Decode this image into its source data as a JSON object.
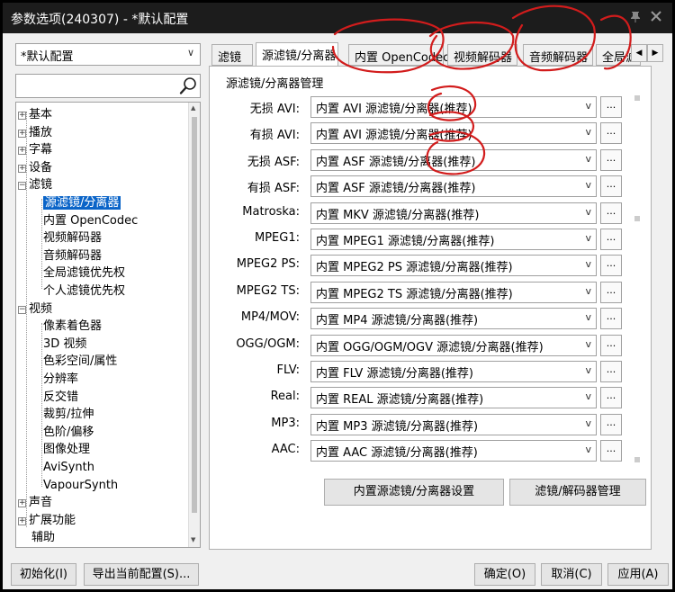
{
  "window": {
    "title": "参数选项(240307) - *默认配置"
  },
  "profile": {
    "selected": "*默认配置"
  },
  "tree": {
    "items": [
      {
        "label": "基本",
        "expander": "+"
      },
      {
        "label": "播放",
        "expander": "+"
      },
      {
        "label": "字幕",
        "expander": "+"
      },
      {
        "label": "设备",
        "expander": "+"
      },
      {
        "label": "滤镜",
        "expander": "−"
      },
      {
        "label": "源滤镜/分离器",
        "selected": true
      },
      {
        "label": "内置 OpenCodec"
      },
      {
        "label": "视频解码器"
      },
      {
        "label": "音频解码器"
      },
      {
        "label": "全局滤镜优先权"
      },
      {
        "label": "个人滤镜优先权"
      },
      {
        "label": "视频",
        "expander": "−"
      },
      {
        "label": "像素着色器"
      },
      {
        "label": "3D 视频"
      },
      {
        "label": "色彩空间/属性"
      },
      {
        "label": "分辨率"
      },
      {
        "label": "反交错"
      },
      {
        "label": "裁剪/拉伸"
      },
      {
        "label": "色阶/偏移"
      },
      {
        "label": "图像处理"
      },
      {
        "label": "AviSynth"
      },
      {
        "label": "VapourSynth"
      },
      {
        "label": "声音",
        "expander": "+"
      },
      {
        "label": "扩展功能",
        "expander": "+"
      },
      {
        "label": "辅助"
      }
    ]
  },
  "tabs": {
    "items": [
      "滤镜",
      "源滤镜/分离器",
      "内置 OpenCodec",
      "视频解码器",
      "音频解码器",
      "全局滤"
    ],
    "active": 1
  },
  "panel": {
    "group_title": "源滤镜/分离器管理",
    "rows": [
      {
        "label": "无损 AVI:",
        "value": "内置 AVI 源滤镜/分离器(推荐)"
      },
      {
        "label": "有损 AVI:",
        "value": "内置 AVI 源滤镜/分离器(推荐)"
      },
      {
        "label": "无损 ASF:",
        "value": "内置 ASF 源滤镜/分离器(推荐)"
      },
      {
        "label": "有损 ASF:",
        "value": "内置 ASF 源滤镜/分离器(推荐)"
      },
      {
        "label": "Matroska:",
        "value": "内置 MKV 源滤镜/分离器(推荐)"
      },
      {
        "label": "MPEG1:",
        "value": "内置 MPEG1 源滤镜/分离器(推荐)"
      },
      {
        "label": "MPEG2 PS:",
        "value": "内置 MPEG2 PS 源滤镜/分离器(推荐)"
      },
      {
        "label": "MPEG2 TS:",
        "value": "内置 MPEG2 TS 源滤镜/分离器(推荐)"
      },
      {
        "label": "MP4/MOV:",
        "value": "内置 MP4 源滤镜/分离器(推荐)"
      },
      {
        "label": "OGG/OGM:",
        "value": "内置 OGG/OGM/OGV 源滤镜/分离器(推荐)"
      },
      {
        "label": "FLV:",
        "value": "内置 FLV 源滤镜/分离器(推荐)"
      },
      {
        "label": "Real:",
        "value": "内置 REAL 源滤镜/分离器(推荐)"
      },
      {
        "label": "MP3:",
        "value": "内置 MP3 源滤镜/分离器(推荐)"
      },
      {
        "label": "AAC:",
        "value": "内置 AAC 源滤镜/分离器(推荐)"
      }
    ],
    "dots_label": "...",
    "combo_arrow": "v",
    "btn_internal": "内置源滤镜/分离器设置",
    "btn_manage": "滤镜/解码器管理"
  },
  "footer": {
    "init": "初始化(I)",
    "export": "导出当前配置(S)...",
    "ok": "确定(O)",
    "cancel": "取消(C)",
    "apply": "应用(A)"
  },
  "icons": {
    "search": "search-icon",
    "pin": "pin-icon",
    "close": "close-icon"
  },
  "colors": {
    "selection": "#0a64c8",
    "annotation": "#d21c1c",
    "titlebar": "#1c1c1c"
  }
}
